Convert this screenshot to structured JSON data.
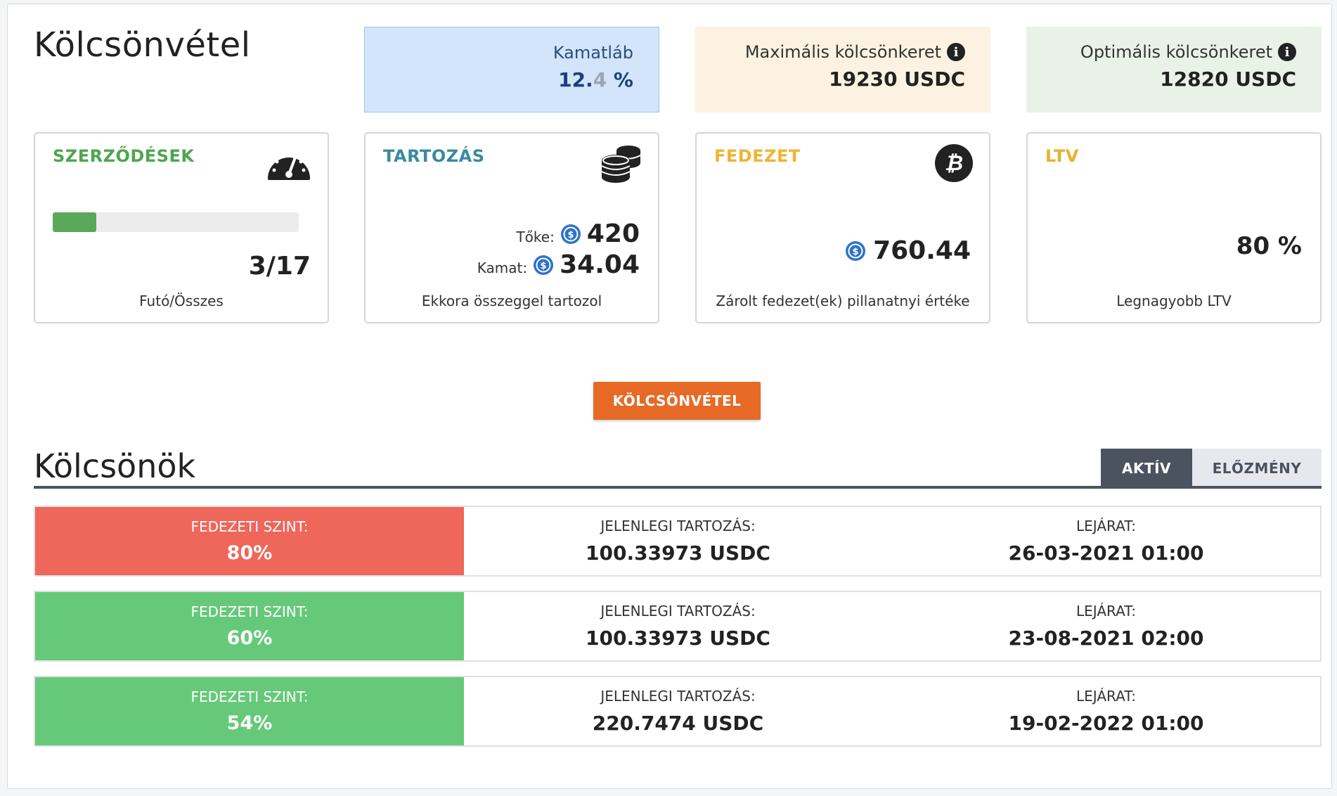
{
  "page": {
    "title": "Kölcsönvétel"
  },
  "info": {
    "rate": {
      "label": "Kamatláb",
      "value_main": "12.",
      "value_dim": "4",
      "value_unit": " %"
    },
    "max_credit": {
      "label": "Maximális kölcsönkeret",
      "value": "19230 USDC",
      "icon": "info-icon"
    },
    "optimal_credit": {
      "label": "Optimális kölcsönkeret",
      "value": "12820 USDC",
      "icon": "info-icon"
    }
  },
  "cards": {
    "contracts": {
      "title": "SZERZŐDÉSEK",
      "icon": "gauge-icon",
      "progress": 0.176,
      "ratio": "3/17",
      "footer": "Futó/Összes"
    },
    "debt": {
      "title": "TARTOZÁS",
      "icon": "coins-icon",
      "principal_label": "Tőke:",
      "principal_value": "420",
      "interest_label": "Kamat:",
      "interest_value": "34.04",
      "footer": "Ekkora összeggel tartozol"
    },
    "collateral": {
      "title": "FEDEZET",
      "icon": "bitcoin-icon",
      "value": "760.44",
      "footer": "Zárolt fedezet(ek) pillanatnyi értéke"
    },
    "ltv": {
      "title": "LTV",
      "value": "80 %",
      "footer": "Legnagyobb LTV"
    }
  },
  "actions": {
    "borrow_button": "KÖLCSÖNVÉTEL"
  },
  "loans": {
    "title": "Kölcsönök",
    "tabs": {
      "active": "AKTÍV",
      "history": "ELŐZMÉNY"
    },
    "level_label": "FEDEZETI SZINT:",
    "debt_label": "JELENLEGI TARTOZÁS:",
    "expiry_label": "LEJÁRAT:",
    "rows": [
      {
        "level": "80%",
        "debt": "100.33973 USDC",
        "expiry": "26-03-2021 01:00",
        "status_color": "#ef665b"
      },
      {
        "level": "60%",
        "debt": "100.33973 USDC",
        "expiry": "23-08-2021 02:00",
        "status_color": "#66c97a"
      },
      {
        "level": "54%",
        "debt": "220.7474 USDC",
        "expiry": "19-02-2022 01:00",
        "status_color": "#66c97a"
      }
    ]
  }
}
